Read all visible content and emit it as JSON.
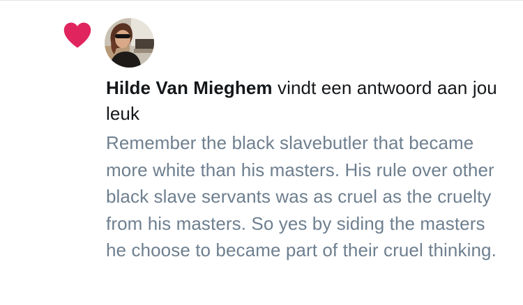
{
  "notification": {
    "user_name": "Hilde Van Mieghem",
    "action_text": "vindt een antwoord aan jou leuk",
    "reply_text": "Remember the black slavebutler that became more white than his masters. His rule over other black slave servants was as cruel as the cruelty from his masters. So yes by siding the masters he choose to became part of their cruel thinking."
  },
  "icons": {
    "like": "heart-icon"
  },
  "colors": {
    "heart": "#e0245e",
    "primary_text": "#14171a",
    "secondary_text": "#6e7f8f",
    "divider": "#e3e3e6"
  }
}
